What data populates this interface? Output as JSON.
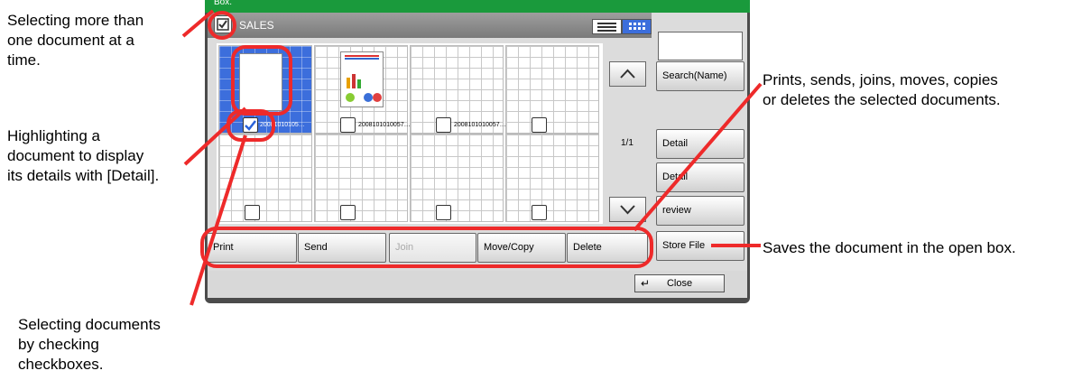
{
  "titlebar": {
    "label": "Box."
  },
  "header": {
    "box_name": "SALES"
  },
  "documents": [
    {
      "name": "20081010105…",
      "selected": true,
      "checked": true
    },
    {
      "name": "2008101010057…",
      "selected": false,
      "checked": false
    },
    {
      "name": "2008101010057…",
      "selected": false,
      "checked": false
    },
    {
      "name": "",
      "selected": false,
      "checked": false
    },
    {
      "name": "",
      "selected": false,
      "checked": false
    },
    {
      "name": "",
      "selected": false,
      "checked": false
    },
    {
      "name": "",
      "selected": false,
      "checked": false
    },
    {
      "name": "",
      "selected": false,
      "checked": false
    }
  ],
  "pagination": {
    "page": "1/1"
  },
  "side": {
    "search_label": "Search(Name)",
    "detail1": "Detail",
    "detail2": "Detail",
    "preview": "review",
    "store_file": "Store File"
  },
  "actions": {
    "print": "Print",
    "send": "Send",
    "join": "Join",
    "move_copy": "Move/Copy",
    "delete": "Delete"
  },
  "footer": {
    "close": "Close"
  },
  "annotations": {
    "select_all": [
      "Selecting more than",
      "one document at a",
      "time."
    ],
    "highlight": [
      "Highlighting a",
      "document to display",
      "its details with [Detail]."
    ],
    "checkboxes": [
      "Selecting documents",
      "by checking",
      "checkboxes."
    ],
    "actions": [
      "Prints, sends, joins, moves, copies",
      "or deletes the selected documents."
    ],
    "store": [
      "Saves the document in the open box."
    ]
  },
  "colors": {
    "accent": "#1a9a3c",
    "highlight": "#3c6edc",
    "callout": "#ee2a2a"
  }
}
